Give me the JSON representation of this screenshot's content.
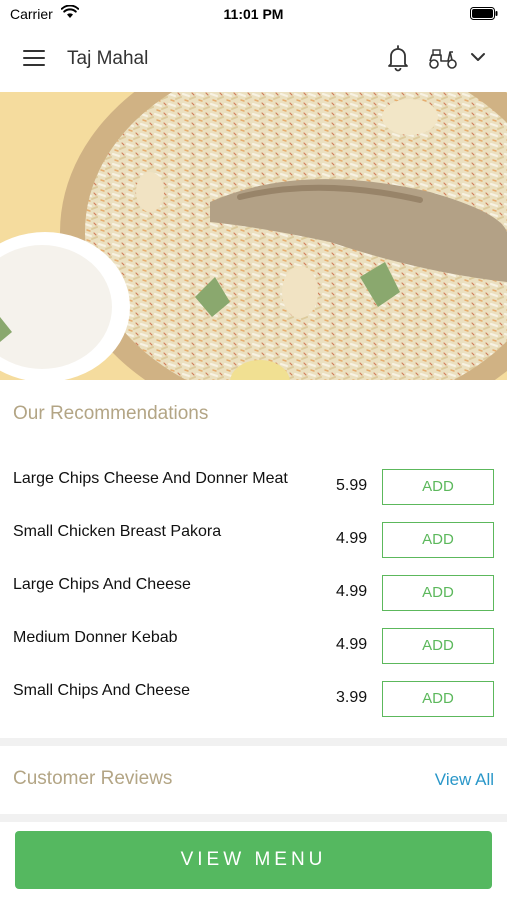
{
  "status_bar": {
    "carrier": "Carrier",
    "time": "11:01 PM"
  },
  "header": {
    "restaurant_name": "Taj Mahal",
    "icons": [
      "menu-icon",
      "bell-icon",
      "scooter-icon",
      "chevron-down-icon"
    ]
  },
  "hero": {
    "image": "biryani-dish-photo"
  },
  "recommendations": {
    "title": "Our Recommendations",
    "items": [
      {
        "name": "Large Chips Cheese And Donner Meat",
        "price": "5.99",
        "button": "ADD"
      },
      {
        "name": "Small Chicken Breast Pakora",
        "price": "4.99",
        "button": "ADD"
      },
      {
        "name": "Large Chips And Cheese",
        "price": "4.99",
        "button": "ADD"
      },
      {
        "name": "Medium Donner Kebab",
        "price": "4.99",
        "button": "ADD"
      },
      {
        "name": "Small Chips And Cheese",
        "price": "3.99",
        "button": "ADD"
      }
    ]
  },
  "reviews": {
    "title": "Customer Reviews",
    "view_all": "View All"
  },
  "footer": {
    "view_menu": "VIEW MENU"
  },
  "colors": {
    "accent_green": "#55b860",
    "section_title": "#b3a585",
    "link_blue": "#2a97c9"
  }
}
